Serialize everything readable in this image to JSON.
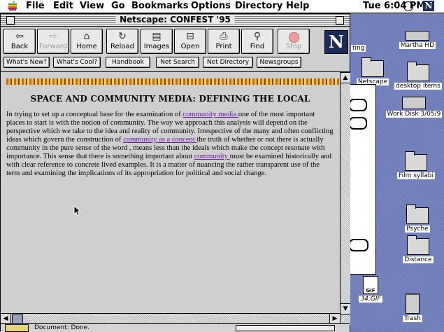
{
  "menubar": {
    "items": [
      "File",
      "Edit",
      "View",
      "Go",
      "Bookmarks",
      "Options",
      "Directory",
      "Help"
    ],
    "clock": "Tue 6:04 PM",
    "app_icon_letter": "N"
  },
  "window": {
    "title": "Netscape: CONFEST '95",
    "toolbar": [
      {
        "label": "Back",
        "icon": "back-arrow-icon",
        "glyph": "⇦"
      },
      {
        "label": "Forward",
        "icon": "forward-arrow-icon",
        "glyph": "⇨"
      },
      {
        "label": "Home",
        "icon": "home-icon",
        "glyph": "⌂"
      },
      {
        "label": "Reload",
        "icon": "reload-icon",
        "glyph": "↻"
      },
      {
        "label": "Images",
        "icon": "images-icon",
        "glyph": "▤"
      },
      {
        "label": "Open",
        "icon": "open-icon",
        "glyph": "⊟"
      },
      {
        "label": "Print",
        "icon": "print-icon",
        "glyph": "⎙"
      },
      {
        "label": "Find",
        "icon": "binoculars-icon",
        "glyph": "⚲"
      },
      {
        "label": "Stop",
        "icon": "stop-icon",
        "glyph": ""
      }
    ],
    "logo_letter": "N",
    "directory_buttons": [
      "What's New?",
      "What's Cool?",
      "Handbook",
      "Net Search",
      "Net Directory",
      "Newsgroups"
    ],
    "heading": "SPACE AND COMMUNITY MEDIA: DEFINING THE LOCAL",
    "paragraph": {
      "t1": "In trying to set up a conceptual base for the examination of ",
      "l1": "community media ",
      "t2": "one of the most important places to start is with the notion of community. The way we approach this analysis will depend on the perspective which we take to the idea and reality of community. Irrespective of the many and often conflicting ideas which govern the construction of ",
      "l2": "community as a concept ",
      "t3": "the truth of whether or not there is actually community in the pure sense of the word , means less than the ideals which make the concept resonate with importance. This sense that there is something important about ",
      "l3": "community ",
      "t4": "must be examined historically and with clear reference to concrete lived examples. It is a matter of nuancing the rather transparent use of the term and examining the implications of its appropriation for political and social change."
    },
    "status": "Document: Done."
  },
  "desktop": {
    "icons": [
      {
        "label": "Martha HD",
        "type": "disk"
      },
      {
        "label": "desktop items",
        "type": "folder"
      },
      {
        "label": "Work Disk 3/05/9",
        "type": "disk"
      },
      {
        "label": "Film syllabi",
        "type": "folder"
      },
      {
        "label": "Psyche",
        "type": "folder"
      },
      {
        "label": "Distance",
        "type": "folder"
      },
      {
        "label": "34.GIF",
        "type": "gif"
      },
      {
        "label": "Trash",
        "type": "trash"
      }
    ],
    "partial_labels": [
      "ting",
      "Netscape"
    ]
  }
}
